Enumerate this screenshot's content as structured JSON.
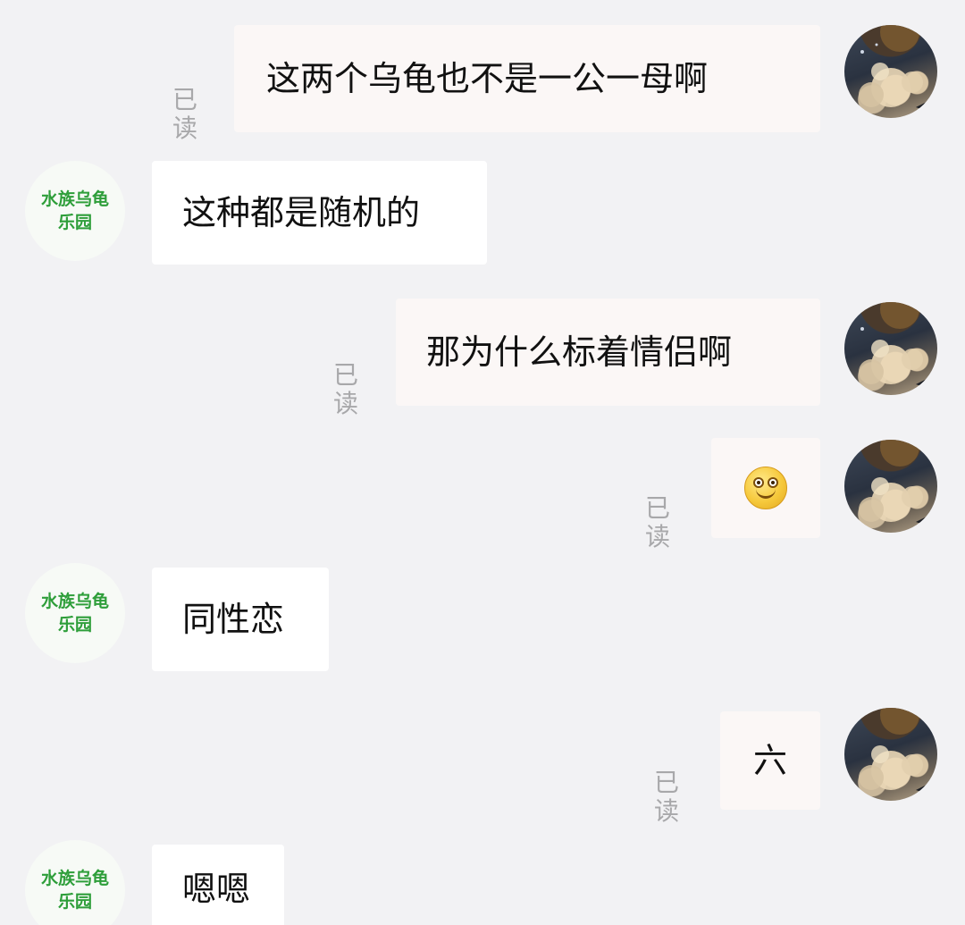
{
  "contact": {
    "name_line1": "水族乌龟",
    "name_line2": "乐园",
    "name_color": "#2e9e3a"
  },
  "messages": [
    {
      "sender": "self",
      "type": "text",
      "text": "这两个乌龟也不是一公一母啊",
      "status": "已读"
    },
    {
      "sender": "other",
      "type": "text",
      "text": "这种都是随机的"
    },
    {
      "sender": "self",
      "type": "text",
      "text": "那为什么标着情侣啊",
      "status": "已读"
    },
    {
      "sender": "self",
      "type": "emoji",
      "emoji": "smile-emoji",
      "status": "已读"
    },
    {
      "sender": "other",
      "type": "text",
      "text": "同性恋"
    },
    {
      "sender": "self",
      "type": "text",
      "text": "六",
      "status": "已读"
    },
    {
      "sender": "other",
      "type": "text",
      "text": "嗯嗯"
    }
  ],
  "colors": {
    "background": "#f2f2f4",
    "bubble_other": "#ffffff",
    "bubble_self": "#fbf7f6",
    "read_status": "#a8a8aa"
  }
}
